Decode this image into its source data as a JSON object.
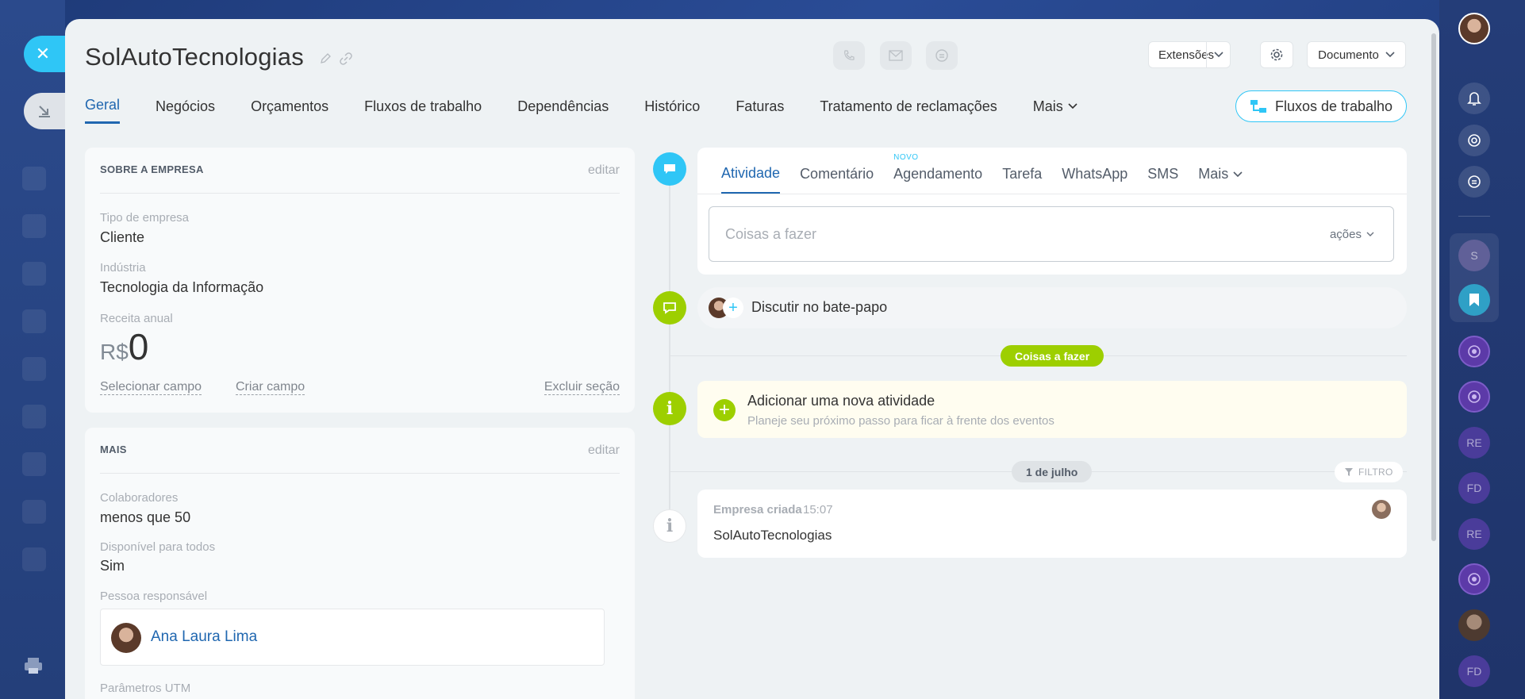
{
  "header": {
    "title": "SolAutoTecnologias",
    "extensions_label": "Extensões",
    "document_label": "Documento"
  },
  "tabs": [
    {
      "label": "Geral"
    },
    {
      "label": "Negócios"
    },
    {
      "label": "Orçamentos"
    },
    {
      "label": "Fluxos de trabalho"
    },
    {
      "label": "Dependências"
    },
    {
      "label": "Histórico"
    },
    {
      "label": "Faturas"
    },
    {
      "label": "Tratamento de reclamações"
    },
    {
      "label": "Mais"
    }
  ],
  "workflow_button": "Fluxos de trabalho",
  "about": {
    "heading": "SOBRE A EMPRESA",
    "edit": "editar",
    "company_type_label": "Tipo de empresa",
    "company_type": "Cliente",
    "industry_label": "Indústria",
    "industry": "Tecnologia da Informação",
    "revenue_label": "Receita anual",
    "currency": "R$",
    "revenue": "0",
    "select_field": "Selecionar campo",
    "create_field": "Criar campo",
    "delete_section": "Excluir seção"
  },
  "more": {
    "heading": "MAIS",
    "edit": "editar",
    "employees_label": "Colaboradores",
    "employees": "menos que 50",
    "available_label": "Disponível para todos",
    "available": "Sim",
    "responsible_label": "Pessoa responsável",
    "responsible": "Ana Laura Lima",
    "utm_label": "Parâmetros UTM"
  },
  "editor": {
    "tabs": [
      {
        "label": "Atividade"
      },
      {
        "label": "Comentário"
      },
      {
        "label": "Agendamento",
        "badge": "NOVO"
      },
      {
        "label": "Tarefa"
      },
      {
        "label": "WhatsApp"
      },
      {
        "label": "SMS"
      },
      {
        "label": "Mais"
      }
    ],
    "placeholder": "Coisas a fazer",
    "actions": "ações"
  },
  "chat": {
    "label": "Discutir no bate-papo"
  },
  "timeline": {
    "todo_pill": "Coisas a fazer",
    "add_title": "Adicionar uma nova atividade",
    "add_sub": "Planeje seu próximo passo para ficar à frente dos eventos",
    "date_pill": "1 de julho",
    "filter": "FILTRO",
    "event_type": "Empresa criada",
    "event_time": "15:07",
    "event_body": "SolAutoTecnologias"
  },
  "sidebar_right": {
    "items": [
      "S",
      "RE",
      "FD",
      "RE",
      "FD"
    ]
  },
  "colors": {
    "accent": "#2067b0",
    "cyan": "#2fc6f6",
    "green": "#9dcf00"
  }
}
